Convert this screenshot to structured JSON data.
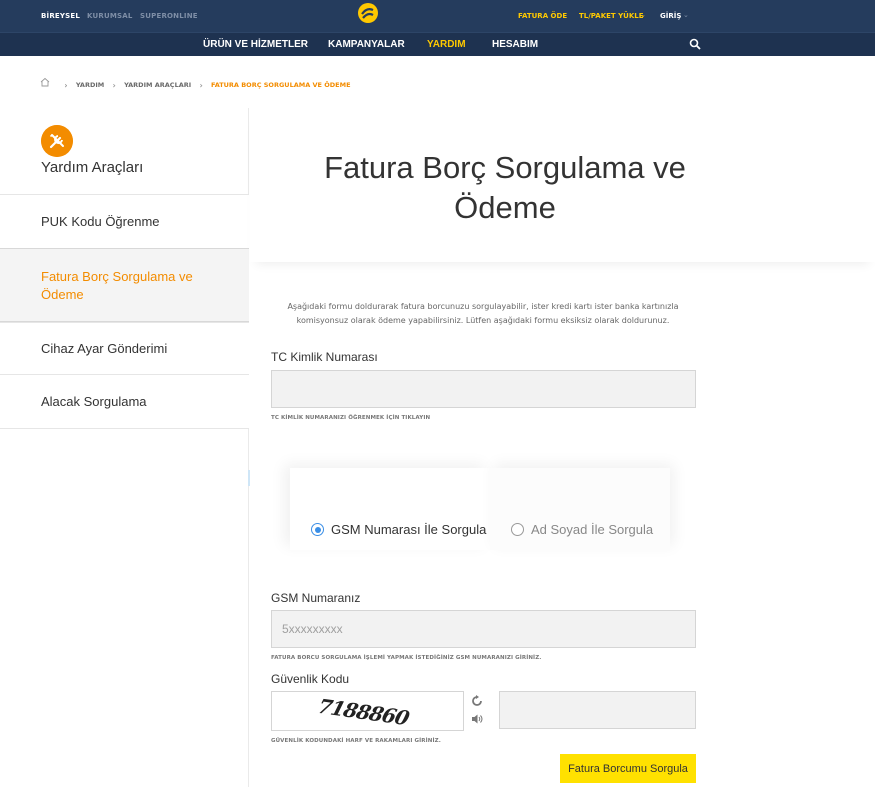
{
  "topbar": {
    "segments": [
      "BİREYSEL",
      "KURUMSAL",
      "SUPERONLINE"
    ],
    "fatura_ode": "FATURA ÖDE",
    "tl_paket_yukle": "TL/PAKET YÜKLE",
    "giris": "GİRİŞ"
  },
  "nav": {
    "items": [
      "ÜRÜN VE HİZMETLER",
      "KAMPANYALAR",
      "YARDIM",
      "HESABIM"
    ],
    "active": "YARDIM"
  },
  "breadcrumb": {
    "items": [
      "YARDIM",
      "YARDIM ARAÇLARI"
    ],
    "current": "FATURA BORÇ SORGULAMA VE ÖDEME"
  },
  "sidebar": {
    "title": "Yardım Araçları",
    "items": [
      {
        "label": "PUK Kodu Öğrenme"
      },
      {
        "label": "Fatura Borç Sorgulama ve Ödeme"
      },
      {
        "label": "Cihaz Ayar Gönderimi"
      },
      {
        "label": "Alacak Sorgulama"
      }
    ]
  },
  "main": {
    "title": "Fatura Borç Sorgulama ve Ödeme",
    "intro": "Aşağıdaki formu doldurarak fatura borcunuzu sorgulayabilir, ister kredi kartı ister banka kartınızla komisyonsuz olarak ödeme yapabilirsiniz.  Lütfen aşağıdaki formu eksiksiz olarak doldurunuz.",
    "tc": {
      "label": "TC Kimlik Numarası",
      "value": "",
      "hint": "TC KİMLİK NUMARANIZI ÖĞRENMEK İÇİN TIKLAYIN"
    },
    "tabs": [
      {
        "label": "GSM Numarası İle Sorgula",
        "selected": true
      },
      {
        "label": "Ad Soyad İle Sorgula",
        "selected": false
      }
    ],
    "gsm": {
      "label": "GSM Numaranız",
      "placeholder": "5xxxxxxxxx",
      "hint": "FATURA BORCU SORGULAMA İŞLEMİ YAPMAK İSTEDİĞİNİZ GSM NUMARANIZI GİRİNİZ."
    },
    "security": {
      "label": "Güvenlik Kodu",
      "captcha_text": "7188860",
      "value": "",
      "hint": "GÜVENLİK KODUNDAKİ HARF VE RAKAMLARI GİRİNİZ."
    },
    "submit_label": "Fatura Borcumu Sorgula"
  },
  "colors": {
    "topbar": "#253c5d",
    "navbar": "#1e3250",
    "accent_yellow": "#ffc900",
    "accent_orange": "#f38c00",
    "button_yellow": "#ffe100",
    "radio_blue": "#3a8ee6"
  }
}
